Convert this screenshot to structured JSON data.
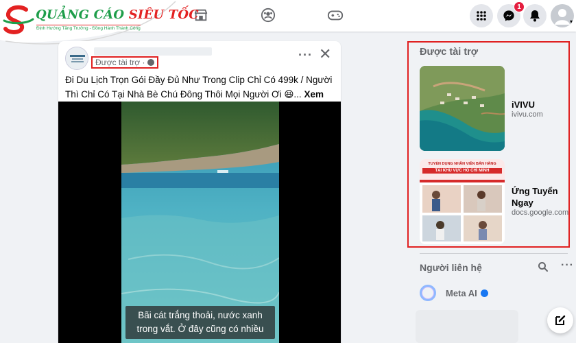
{
  "logo": {
    "brand_part1": "QUẢNG CÁO",
    "brand_part2": "SIÊU TỐC",
    "tagline": "Định Hướng Tăng Trưởng - Đồng Hành Thành Công"
  },
  "nav": {
    "icons": [
      "marketplace-icon",
      "groups-icon",
      "gaming-icon"
    ],
    "right_icons": [
      "menu-grid-icon",
      "messenger-icon",
      "notifications-icon",
      "account-icon"
    ],
    "messenger_badge": "1"
  },
  "post": {
    "sponsored_label": "Được tài trợ ·",
    "caption": "Đi Du Lịch Trọn Gói Đầy Đủ Như Trong Clip Chỉ Có 499k / Người Thì Chỉ Có Tại Nhà Bè Chú Đông Thôi Mọi Người Ơi 😆...",
    "see_more": "Xem thêm",
    "video_subtitle": "Bãi cát trắng thoải, nước xanh trong vắt. Ở đây cũng có nhiều"
  },
  "sidebar": {
    "sponsored_heading": "Được tài trợ",
    "ads": [
      {
        "title": "iVIVU",
        "url": "ivivu.com"
      },
      {
        "title": "Ứng Tuyển Ngay",
        "url": "docs.google.com",
        "image_text": "TUYỂN DỤNG NHÂN VIÊN BÁN HÀNG",
        "image_text2": "TẠI KHU VỰC HỒ CHÍ MINH"
      }
    ],
    "contacts_heading": "Người liên hệ",
    "contacts": [
      {
        "name": "Meta AI"
      }
    ]
  },
  "colors": {
    "highlight_border": "#e02020",
    "facebook_blue": "#1877f2",
    "badge_red": "#e41e3f"
  }
}
